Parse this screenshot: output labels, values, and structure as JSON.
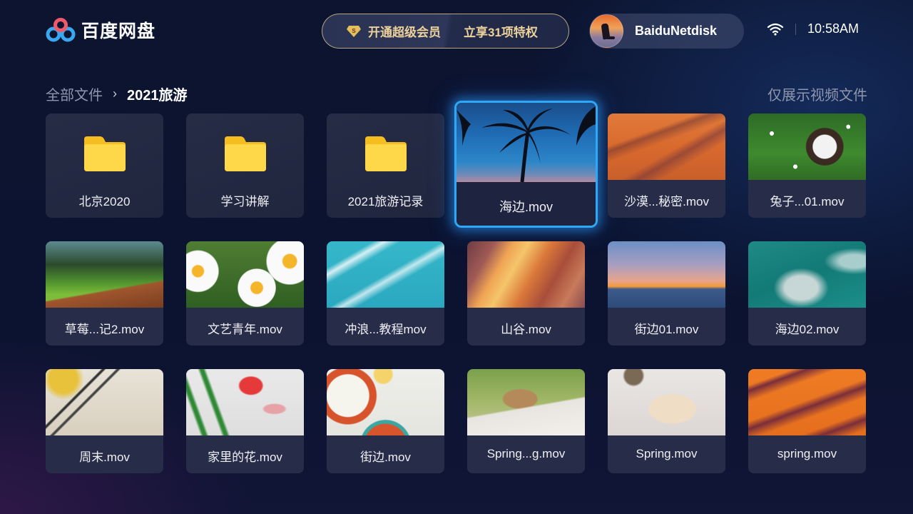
{
  "app": {
    "logo_text": "百度网盘",
    "brand_colors": {
      "logo_blue": "#3aa8f0",
      "logo_red": "#ef5a6a"
    }
  },
  "header": {
    "vip_promo": {
      "left_text": "开通超级会员",
      "right_text": "立享31项特权",
      "badge_icon": "vip-diamond-icon",
      "text_color": "#ecd19a"
    },
    "user": {
      "name": "BaiduNetdisk",
      "avatar_icon": "user-avatar"
    },
    "status": {
      "wifi_icon": "wifi-icon",
      "time": "10:58AM"
    }
  },
  "breadcrumb": {
    "root": "全部文件",
    "separator": "›",
    "current": "2021旅游"
  },
  "filter": {
    "label": "仅展示视频文件"
  },
  "focus_color": "#2fa8f5",
  "files": [
    {
      "type": "folder",
      "name": "北京2020"
    },
    {
      "type": "folder",
      "name": "学习讲解"
    },
    {
      "type": "folder",
      "name": "2021旅游记录"
    },
    {
      "type": "video",
      "name": "海边.mov",
      "thumb": "palm-tree",
      "focused": true
    },
    {
      "type": "video",
      "name": "沙漠...秘密.mov",
      "thumb": "desert-dunes"
    },
    {
      "type": "video",
      "name": "兔子...01.mov",
      "thumb": "rabbit"
    },
    {
      "type": "video",
      "name": "草莓...记2.mov",
      "thumb": "mountain-cabin"
    },
    {
      "type": "video",
      "name": "文艺青年.mov",
      "thumb": "daisies"
    },
    {
      "type": "video",
      "name": "冲浪...教程mov",
      "thumb": "surfers"
    },
    {
      "type": "video",
      "name": "山谷.mov",
      "thumb": "canyon"
    },
    {
      "type": "video",
      "name": "街边01.mov",
      "thumb": "sunset-swing"
    },
    {
      "type": "video",
      "name": "海边02.mov",
      "thumb": "ocean-waves"
    },
    {
      "type": "video",
      "name": "周末.mov",
      "thumb": "painting-desk"
    },
    {
      "type": "video",
      "name": "家里的花.mov",
      "thumb": "tulips"
    },
    {
      "type": "video",
      "name": "街边.mov",
      "thumb": "food-bowls"
    },
    {
      "type": "video",
      "name": "Spring...g.mov",
      "thumb": "picnic"
    },
    {
      "type": "video",
      "name": "Spring.mov",
      "thumb": "open-book"
    },
    {
      "type": "video",
      "name": "spring.mov",
      "thumb": "orange-dunes"
    }
  ]
}
